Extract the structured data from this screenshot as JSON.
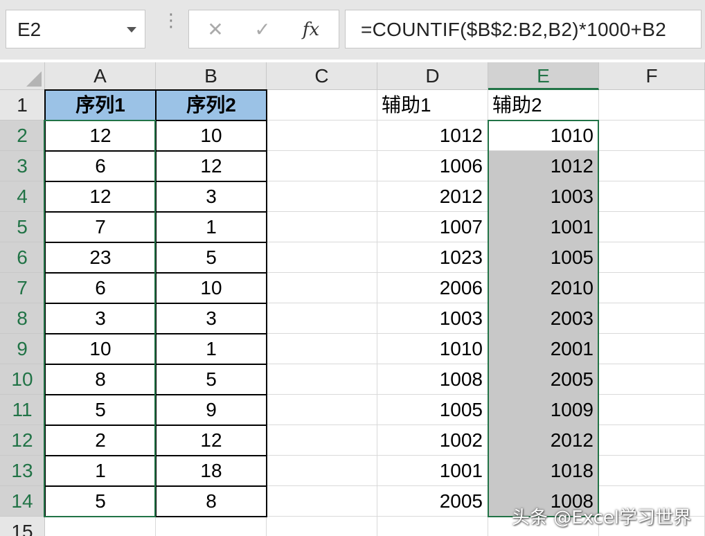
{
  "formula_bar": {
    "name_box": "E2",
    "separator": "⋮",
    "cancel_icon": "✕",
    "enter_icon": "✓",
    "fx_label": "fx",
    "formula": "=COUNTIF($B$2:B2,B2)*1000+B2"
  },
  "columns": [
    "A",
    "B",
    "C",
    "D",
    "E",
    "F"
  ],
  "rows": [
    "1",
    "2",
    "3",
    "4",
    "5",
    "6",
    "7",
    "8",
    "9",
    "10",
    "11",
    "12",
    "13",
    "14",
    "15"
  ],
  "headers": {
    "A": "序列1",
    "B": "序列2",
    "D": "辅助1",
    "E": "辅助2"
  },
  "data": [
    {
      "A": "12",
      "B": "10",
      "D": "1012",
      "E": "1010"
    },
    {
      "A": "6",
      "B": "12",
      "D": "1006",
      "E": "1012"
    },
    {
      "A": "12",
      "B": "3",
      "D": "2012",
      "E": "1003"
    },
    {
      "A": "7",
      "B": "1",
      "D": "1007",
      "E": "1001"
    },
    {
      "A": "23",
      "B": "5",
      "D": "1023",
      "E": "1005"
    },
    {
      "A": "6",
      "B": "10",
      "D": "2006",
      "E": "2010"
    },
    {
      "A": "3",
      "B": "3",
      "D": "1003",
      "E": "2003"
    },
    {
      "A": "10",
      "B": "1",
      "D": "1010",
      "E": "2001"
    },
    {
      "A": "8",
      "B": "5",
      "D": "1008",
      "E": "2005"
    },
    {
      "A": "5",
      "B": "9",
      "D": "1005",
      "E": "1009"
    },
    {
      "A": "2",
      "B": "12",
      "D": "1002",
      "E": "2012"
    },
    {
      "A": "1",
      "B": "18",
      "D": "1001",
      "E": "1018"
    },
    {
      "A": "5",
      "B": "8",
      "D": "2005",
      "E": "1008"
    }
  ],
  "active_cell": "E2",
  "colors": {
    "header_fill": "#9bc2e6",
    "selection_fill": "#c8c8c8",
    "accent_green": "#217346"
  },
  "watermark": "头条 @Excel学习世界"
}
